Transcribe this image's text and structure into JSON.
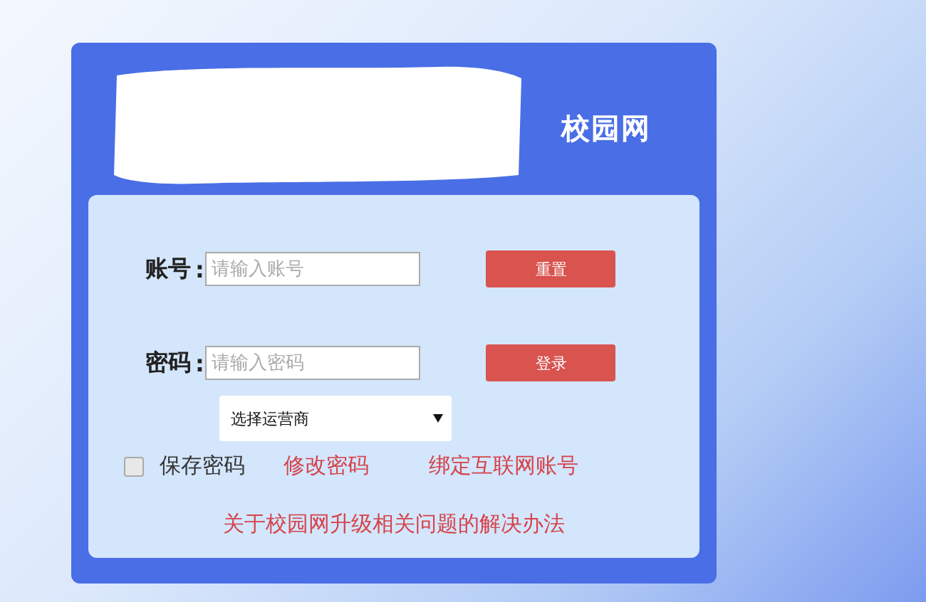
{
  "logo": {
    "text": "校园网"
  },
  "fields": [
    {
      "label": "账号",
      "colon": ":",
      "placeholder": "请输入账号",
      "button": "重置"
    },
    {
      "label": "密码",
      "colon": ":",
      "placeholder": "请输入密码",
      "button": "登录"
    }
  ],
  "carrier_select": {
    "value": "选择运营商"
  },
  "remember": {
    "label": "保存密码",
    "checked": false
  },
  "links": [
    "修改密码",
    "绑定互联网账号"
  ],
  "help_link": "关于校园网升级相关问题的解决办法"
}
